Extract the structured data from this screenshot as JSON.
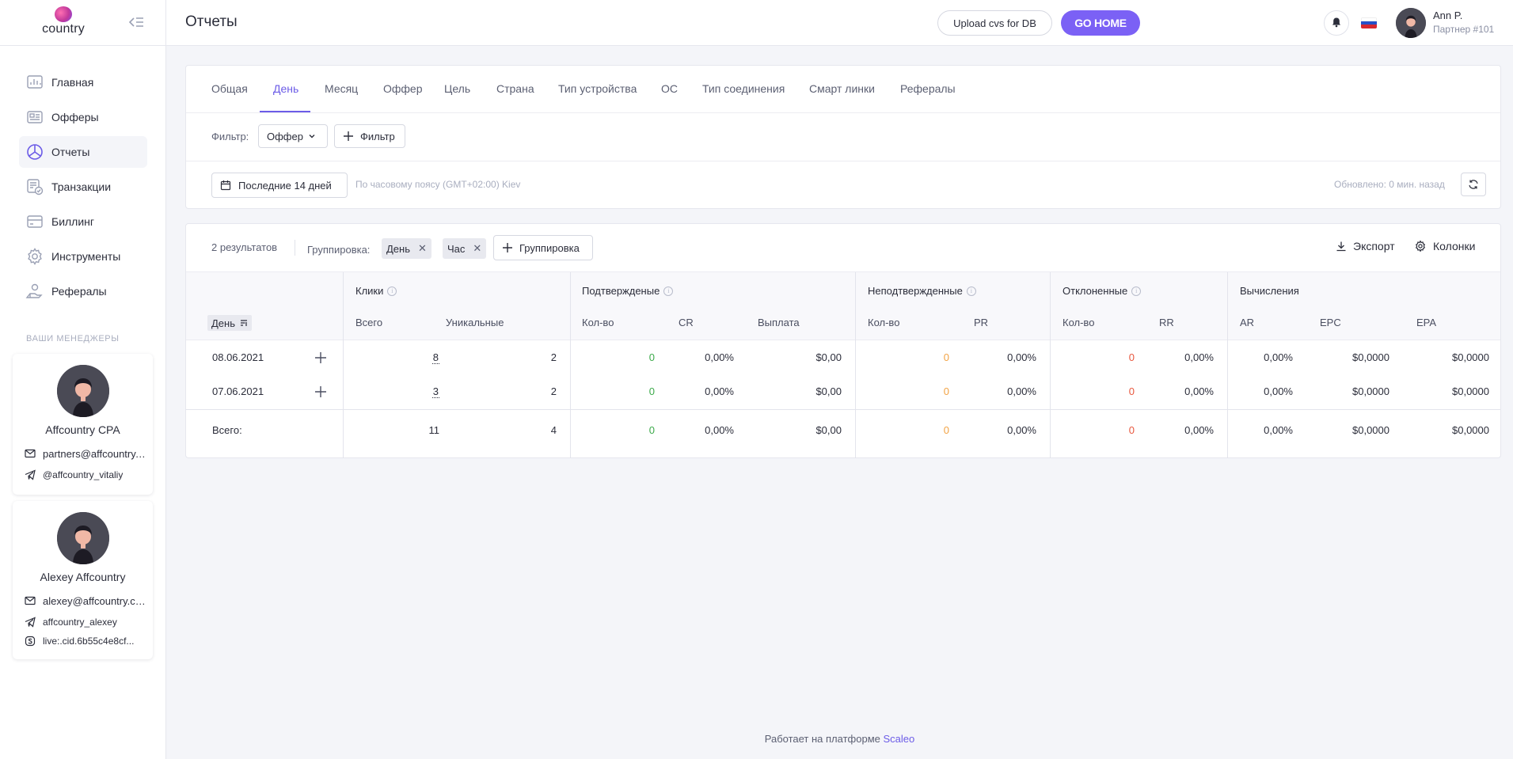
{
  "app": {
    "logo_text": "country",
    "logo_mark": "ON"
  },
  "header": {
    "title": "Отчеты",
    "upload_label": "Upload cvs for DB",
    "gohome_label": "GO HOME",
    "user_name": "Ann P.",
    "user_role": "Партнер #101"
  },
  "sidebar": {
    "items": [
      {
        "label": "Главная",
        "icon": "dashboard-icon"
      },
      {
        "label": "Офферы",
        "icon": "offers-icon"
      },
      {
        "label": "Отчеты",
        "icon": "reports-icon",
        "active": true
      },
      {
        "label": "Транзакции",
        "icon": "transactions-icon"
      },
      {
        "label": "Биллинг",
        "icon": "billing-icon"
      },
      {
        "label": "Инструменты",
        "icon": "gear-icon"
      },
      {
        "label": "Рефералы",
        "icon": "referrals-icon"
      }
    ],
    "managers_title": "ВАШИ МЕНЕДЖЕРЫ",
    "managers": [
      {
        "name": "Affcountry CPA",
        "email": "partners@affcountry.com",
        "telegram": "@affcountry_vitaliy"
      },
      {
        "name": "Alexey Affcountry",
        "email": "alexey@affcountry.com",
        "telegram": "affcountry_alexey",
        "skype": "live:.cid.6b55c4e8cf..."
      }
    ]
  },
  "filters": {
    "tabs": [
      "Общая",
      "День",
      "Месяц",
      "Оффер",
      "Цель",
      "Страна",
      "Тип устройства",
      "ОС",
      "Тип соединения",
      "Смарт линки",
      "Рефералы"
    ],
    "active_tab": "День",
    "filter_label": "Фильтр:",
    "offer_dropdown": "Оффер",
    "add_filter": "Фильтр",
    "date_range": "Последние 14 дней",
    "timezone": "По часовому поясу (GMT+02:00) Kiev",
    "updated": "Обновлено: 0 мин. назад"
  },
  "table": {
    "results": "2 результатов",
    "group_label": "Группировка:",
    "group_tags": [
      "День",
      "Час"
    ],
    "add_group": "Группировка",
    "export": "Экспорт",
    "columns": "Колонки",
    "groups": {
      "clicks": "Клики",
      "confirmed": "Подтвержденые",
      "unconfirmed": "Неподтвержденные",
      "rejected": "Отклоненные",
      "calc": "Вычисления"
    },
    "headers": {
      "day": "День",
      "total": "Всего",
      "unique": "Уникальные",
      "qty1": "Кол-во",
      "cr": "CR",
      "payout": "Выплата",
      "qty2": "Кол-во",
      "pr": "PR",
      "qty3": "Кол-во",
      "rr": "RR",
      "ar": "AR",
      "epc": "EPC",
      "epa": "EPA"
    },
    "rows": [
      {
        "day": "08.06.2021",
        "total": "8",
        "unique": "2",
        "conf": "0",
        "cr": "0,00%",
        "payout": "$0,00",
        "unconf": "0",
        "pr": "0,00%",
        "rej": "0",
        "rr": "0,00%",
        "ar": "0,00%",
        "epc": "$0,0000",
        "epa": "$0,0000"
      },
      {
        "day": "07.06.2021",
        "total": "3",
        "unique": "2",
        "conf": "0",
        "cr": "0,00%",
        "payout": "$0,00",
        "unconf": "0",
        "pr": "0,00%",
        "rej": "0",
        "rr": "0,00%",
        "ar": "0,00%",
        "epc": "$0,0000",
        "epa": "$0,0000"
      }
    ],
    "totals": {
      "label": "Всего:",
      "total": "11",
      "unique": "4",
      "conf": "0",
      "cr": "0,00%",
      "payout": "$0,00",
      "unconf": "0",
      "pr": "0,00%",
      "rej": "0",
      "rr": "0,00%",
      "ar": "0,00%",
      "epc": "$0,0000",
      "epa": "$0,0000"
    }
  },
  "footer": {
    "text": "Работает на платформе",
    "brand": "Scaleo"
  },
  "colors": {
    "accent": "#7b61f5",
    "confirmed": "#3caa4a",
    "pending": "#f2a344",
    "rejected": "#e8573e"
  }
}
